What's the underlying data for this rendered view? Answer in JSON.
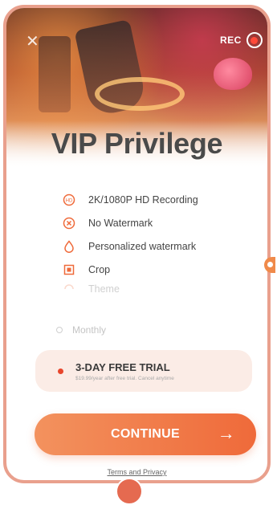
{
  "header": {
    "close_icon": "close-icon",
    "rec_label": "REC",
    "rec_color": "#ff4a3a"
  },
  "title": "VIP Privilege",
  "features": [
    {
      "icon": "hd-icon",
      "label": "2K/1080P HD Recording"
    },
    {
      "icon": "no-watermark-icon",
      "label": "No Watermark"
    },
    {
      "icon": "watermark-drop-icon",
      "label": "Personalized watermark"
    },
    {
      "icon": "crop-icon",
      "label": "Crop"
    },
    {
      "icon": "theme-icon",
      "label": "Theme"
    }
  ],
  "plans": {
    "monthly_label": "Monthly",
    "trial_title": "3-DAY FREE TRIAL",
    "trial_subtitle": "$19.99/year after free trial. Cancel anytime"
  },
  "continue_label": "CONTINUE",
  "continue_arrow": "→",
  "terms_label": "Terms and Privacy",
  "colors": {
    "accent": "#ef6a3a",
    "frame": "#e9a08d",
    "trial_bg": "#fbece6"
  }
}
